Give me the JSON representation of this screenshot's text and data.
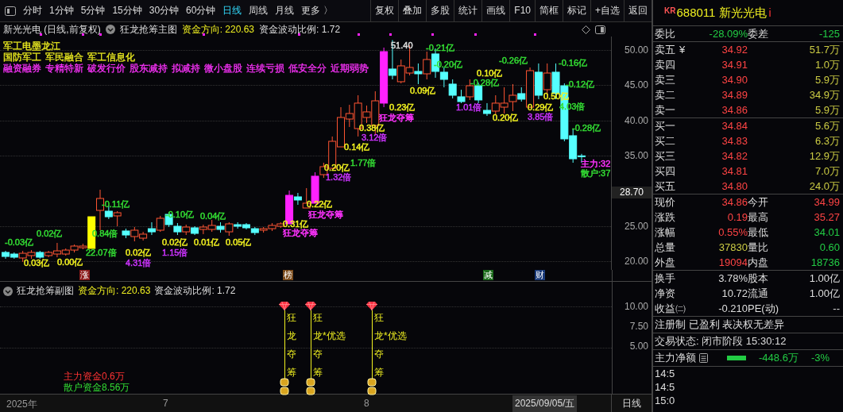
{
  "toolbar": {
    "periods": [
      {
        "label": "分时",
        "selected": false
      },
      {
        "label": "1分钟",
        "selected": false
      },
      {
        "label": "5分钟",
        "selected": false
      },
      {
        "label": "15分钟",
        "selected": false
      },
      {
        "label": "30分钟",
        "selected": false
      },
      {
        "label": "60分钟",
        "selected": false
      },
      {
        "label": "日线",
        "selected": true
      },
      {
        "label": "周线",
        "selected": false
      },
      {
        "label": "月线",
        "selected": false
      }
    ],
    "more": "更多 〉",
    "actions": [
      "复权",
      "叠加",
      "多股",
      "统计",
      "画线",
      "F10",
      "简框",
      "标记",
      "+自选",
      "返回"
    ]
  },
  "main_chart": {
    "title": "新光光电 (日线,前复权)",
    "indicator": "狂龙抢筹主图",
    "fund_direction": "资金方向: 220.63",
    "fund_ratio": "资金波动比例: 1.72",
    "concept_lines": [
      {
        "color": "#f0f020",
        "tags": [
          "军工电墨龙江"
        ]
      },
      {
        "color": "#f0f020",
        "tags": [
          "国防军工",
          "军民融合",
          "军工信息化"
        ]
      },
      {
        "color": "#ff33ff",
        "tags": [
          "融资融券",
          "专精特新",
          "破发行价",
          "股东减持",
          "拟减持",
          "微小盘股",
          "连续亏损",
          "低安全分",
          "近期弱势"
        ]
      }
    ],
    "chart_data": {
      "type": "candlestick",
      "ylim": [
        18.81,
        51.91
      ],
      "grid": true,
      "yticks": [
        {
          "value": 50,
          "label": "50.00"
        },
        {
          "value": 45,
          "label": "45.00"
        },
        {
          "value": 40,
          "label": "40.00"
        },
        {
          "value": 35,
          "label": "35.00"
        },
        {
          "value": 25,
          "label": "25.00"
        },
        {
          "value": 20,
          "label": "20.00"
        }
      ],
      "ohlc": [
        [
          21.29,
          21.51,
          20.39,
          20.72
        ],
        [
          21.06,
          21.29,
          20.39,
          20.61
        ],
        [
          20.5,
          21.51,
          19.94,
          21.17
        ],
        [
          20.84,
          21.62,
          20.39,
          21.29
        ],
        [
          21.29,
          21.51,
          20.39,
          20.61
        ],
        [
          20.84,
          21.51,
          20.61,
          21.29
        ],
        [
          21.06,
          22.64,
          20.61,
          21.51
        ],
        [
          21.06,
          21.85,
          20.84,
          21.62
        ],
        [
          21.62,
          22.41,
          21.29,
          22.19
        ],
        [
          21.96,
          22.53,
          21.74,
          22.19
        ],
        [
          21.85,
          26.35,
          21.85,
          26.35
        ],
        [
          27.25,
          30.18,
          24.44,
          28.94
        ],
        [
          27.14,
          27.93,
          26.02,
          26.35
        ],
        [
          26.47,
          27.14,
          25.0,
          26.92
        ],
        [
          24.33,
          24.66,
          23.31,
          23.76
        ],
        [
          23.54,
          24.89,
          22.86,
          24.44
        ],
        [
          23.31,
          24.21,
          22.98,
          23.88
        ],
        [
          24.66,
          25.57,
          23.76,
          24.21
        ],
        [
          24.44,
          26.47,
          24.21,
          26.13
        ],
        [
          26.69,
          27.03,
          24.89,
          25.23
        ],
        [
          25.0,
          25.45,
          23.76,
          24.21
        ],
        [
          24.21,
          25.23,
          23.76,
          24.89
        ],
        [
          24.78,
          25.0,
          23.76,
          23.99
        ],
        [
          24.55,
          25.23,
          23.88,
          24.89
        ],
        [
          24.55,
          25.9,
          24.21,
          25.12
        ],
        [
          25.0,
          25.57,
          24.1,
          24.55
        ],
        [
          24.21,
          25.57,
          23.65,
          25.34
        ],
        [
          25.23,
          25.57,
          24.66,
          25.0
        ],
        [
          25.23,
          25.45,
          24.55,
          24.78
        ],
        [
          24.66,
          24.89,
          23.76,
          24.1
        ],
        [
          24.44,
          24.89,
          24.1,
          24.66
        ],
        [
          24.66,
          25.45,
          24.33,
          25.12
        ],
        [
          25.0,
          25.57,
          24.78,
          25.34
        ],
        [
          25.34,
          30.07,
          25.34,
          29.39
        ],
        [
          29.17,
          29.73,
          28.04,
          28.72
        ],
        [
          27.59,
          30.41,
          27.59,
          28.27
        ],
        [
          28.27,
          32.66,
          28.27,
          32.1
        ],
        [
          32.32,
          34.01,
          31.87,
          33.45
        ],
        [
          33.22,
          37.73,
          33.11,
          37.05
        ],
        [
          36.26,
          41.89,
          36.26,
          40.43
        ],
        [
          40.2,
          42.23,
          39.08,
          40.99
        ],
        [
          38.85,
          43.58,
          37.73,
          42.46
        ],
        [
          40.43,
          42.12,
          39.64,
          41.22
        ],
        [
          39.3,
          44.14,
          37.95,
          42.79
        ],
        [
          42.46,
          50.34,
          41.89,
          49.77
        ],
        [
          47.3,
          51.4,
          45.83,
          46.4
        ],
        [
          45.5,
          48.65,
          45.27,
          47.75
        ],
        [
          46.73,
          50.68,
          46.4,
          47.52
        ],
        [
          46.96,
          48.09,
          45.16,
          46.62
        ],
        [
          46.62,
          49.77,
          45.83,
          48.65
        ],
        [
          49.44,
          50.23,
          46.06,
          46.96
        ],
        [
          46.85,
          47.52,
          44.71,
          45.83
        ],
        [
          45.16,
          45.83,
          43.13,
          43.58
        ],
        [
          43.36,
          44.37,
          42.46,
          42.68
        ],
        [
          43.36,
          45.83,
          42.91,
          44.93
        ],
        [
          44.93,
          45.38,
          42.46,
          42.91
        ],
        [
          41.44,
          42.46,
          40.65,
          40.99
        ],
        [
          41.33,
          43.58,
          40.77,
          42.46
        ],
        [
          41.89,
          44.71,
          40.99,
          42.46
        ],
        [
          42.68,
          45.16,
          41.33,
          43.58
        ],
        [
          43.81,
          44.71,
          42.68,
          43.02
        ],
        [
          41.89,
          47.52,
          41.78,
          47.07
        ],
        [
          46.85,
          48.09,
          43.02,
          43.58
        ],
        [
          44.37,
          48.09,
          43.58,
          46.73
        ],
        [
          46.85,
          48.09,
          43.02,
          43.81
        ],
        [
          44.93,
          45.27,
          37.05,
          37.39
        ],
        [
          37.84,
          38.85,
          34.01,
          34.57
        ],
        [
          34.99,
          35.27,
          34.01,
          34.86
        ]
      ],
      "colors": [
        null,
        null,
        null,
        null,
        null,
        null,
        null,
        null,
        null,
        null,
        "#ffff00",
        null,
        null,
        null,
        null,
        null,
        null,
        null,
        null,
        null,
        null,
        null,
        null,
        null,
        null,
        null,
        null,
        null,
        null,
        null,
        null,
        null,
        null,
        "#ff22ff",
        null,
        null,
        "#ff22ff",
        null,
        null,
        null,
        null,
        null,
        null,
        null,
        "#ff22ff",
        null,
        null,
        null,
        null,
        null,
        null,
        null,
        null,
        null,
        null,
        null,
        null,
        null,
        null,
        null,
        null,
        null,
        null,
        null,
        null,
        null,
        null,
        null
      ]
    },
    "annotations": [
      {
        "text": "51.40",
        "color": "#dddddd"
      },
      {
        "text": "-0.21亿",
        "color": "#33dd33"
      },
      {
        "text": "-0.20亿",
        "color": "#33dd33"
      },
      {
        "text": "-0.26亿",
        "color": "#33dd33"
      },
      {
        "text": "-0.16亿",
        "color": "#33dd33"
      },
      {
        "text": "0.10亿",
        "color": "#f0f020"
      },
      {
        "text": "0.09亿",
        "color": "#f0f020"
      },
      {
        "text": "-0.28亿",
        "color": "#33dd33"
      },
      {
        "text": "-0.12亿",
        "color": "#33dd33"
      },
      {
        "text": "0.50亿",
        "color": "#f0f020"
      },
      {
        "text": "0.23亿",
        "color": "#f0f020"
      },
      {
        "text": "1.01倍",
        "color": "#cc33ff"
      },
      {
        "text": "0.29亿",
        "color": "#f0f020"
      },
      {
        "text": "4.03倍",
        "color": "#33dd33"
      },
      {
        "text": "狂龙夺筹",
        "color": "#ff33ff"
      },
      {
        "text": "0.20亿",
        "color": "#f0f020"
      },
      {
        "text": "3.85倍",
        "color": "#cc33ff"
      },
      {
        "text": "0.38亿",
        "color": "#f0f020"
      },
      {
        "text": "-0.28亿",
        "color": "#33dd33"
      },
      {
        "text": "3.12倍",
        "color": "#cc33ff"
      },
      {
        "text": "0.14亿",
        "color": "#f0f020"
      },
      {
        "text": "0.20亿",
        "color": "#f0f020"
      },
      {
        "text": "1.77倍",
        "color": "#33dd33"
      },
      {
        "text": "主力:32",
        "color": "#ff33ff"
      },
      {
        "text": "1.32倍",
        "color": "#cc33ff"
      },
      {
        "text": "散户:37",
        "color": "#33dd33"
      },
      {
        "text": "-0.11亿",
        "color": "#33dd33"
      },
      {
        "text": "0.22亿",
        "color": "#f0f020"
      },
      {
        "text": "-0.10亿",
        "color": "#33dd33"
      },
      {
        "text": "0.04亿",
        "color": "#33dd33"
      },
      {
        "text": "狂龙夺筹",
        "color": "#ff33ff"
      },
      {
        "text": "0.31亿",
        "color": "#f0f020"
      },
      {
        "text": "0.02亿",
        "color": "#33dd33"
      },
      {
        "text": "0.84倍",
        "color": "#33dd33"
      },
      {
        "text": "狂龙夺筹",
        "color": "#ff33ff"
      },
      {
        "text": "-0.03亿",
        "color": "#33dd33"
      },
      {
        "text": "0.02亿",
        "color": "#f0f020"
      },
      {
        "text": "0.01亿",
        "color": "#f0f020"
      },
      {
        "text": "0.05亿",
        "color": "#f0f020"
      },
      {
        "text": "22.07倍",
        "color": "#33dd33"
      },
      {
        "text": "0.02亿",
        "color": "#f0f020"
      },
      {
        "text": "1.15倍",
        "color": "#cc33ff"
      },
      {
        "text": "0.03亿",
        "color": "#f0f020"
      },
      {
        "text": "0.00亿",
        "color": "#f0f020"
      },
      {
        "text": "4.31倍",
        "color": "#cc33ff"
      }
    ],
    "current_price": "28.70"
  },
  "event_markers": [
    {
      "label": "涨",
      "color": "#8b1a1a"
    },
    {
      "label": "榜",
      "color": "#7a4a1a"
    },
    {
      "label": "减",
      "color": "#1a6a1a"
    },
    {
      "label": "财",
      "color": "#1a3a7a"
    }
  ],
  "sub_chart": {
    "indicator": "狂龙抢筹副图",
    "fund_direction": "资金方向: 220.63",
    "fund_ratio": "资金波动比例: 1.72",
    "ticks": [
      "10.00",
      "7.50",
      "5.00"
    ],
    "signals": [
      {
        "lines": [
          "狂",
          "龙",
          "夺",
          "筹"
        ]
      },
      {
        "lines": [
          "狂",
          "龙*优选",
          "夺",
          "筹"
        ]
      },
      {
        "lines": [
          "狂",
          "龙*优选",
          "夺",
          "筹"
        ]
      }
    ],
    "main_fund": "主力资金0.6万",
    "retail_fund": "散户资金8.56万"
  },
  "date_axis": {
    "labels": [
      "2025年",
      "7",
      "8"
    ],
    "cursor_date": "2025/09/05/五",
    "period": "日线"
  },
  "quote_panel": {
    "badge": "KR",
    "code": "688011",
    "name": "新光光电",
    "info_mark": "i",
    "order_ratio": [
      {
        "label": "委比",
        "value": "-28.09%",
        "color": "#22cc44"
      },
      {
        "label": "委差",
        "value": "-125",
        "color": "#22cc44"
      }
    ],
    "ask_symbol": "¥",
    "asks": [
      {
        "label": "卖五",
        "price": "34.92",
        "volume": "51.7万"
      },
      {
        "label": "卖四",
        "price": "34.91",
        "volume": "1.0万"
      },
      {
        "label": "卖三",
        "price": "34.90",
        "volume": "5.9万"
      },
      {
        "label": "卖二",
        "price": "34.89",
        "volume": "34.9万"
      },
      {
        "label": "卖一",
        "price": "34.86",
        "volume": "5.9万"
      }
    ],
    "bids": [
      {
        "label": "买一",
        "price": "34.84",
        "volume": "5.6万"
      },
      {
        "label": "买二",
        "price": "34.83",
        "volume": "6.3万"
      },
      {
        "label": "买三",
        "price": "34.82",
        "volume": "12.9万"
      },
      {
        "label": "买四",
        "price": "34.81",
        "volume": "7.0万"
      },
      {
        "label": "买五",
        "price": "34.80",
        "volume": "24.0万"
      }
    ],
    "stats": [
      [
        {
          "label": "现价",
          "value": "34.86",
          "color": "#ff4444"
        },
        {
          "label": "今开",
          "value": "34.99",
          "color": "#ff4444"
        }
      ],
      [
        {
          "label": "涨跌",
          "value": "0.19",
          "color": "#ff4444"
        },
        {
          "label": "最高",
          "value": "35.27",
          "color": "#ff4444"
        }
      ],
      [
        {
          "label": "涨幅",
          "value": "0.55%",
          "color": "#ff4444"
        },
        {
          "label": "最低",
          "value": "34.01",
          "color": "#22cc44"
        }
      ],
      [
        {
          "label": "总量",
          "value": "37830",
          "color": "#cccc44"
        },
        {
          "label": "量比",
          "value": "0.60",
          "color": "#22cc44"
        }
      ],
      [
        {
          "label": "外盘",
          "value": "19094",
          "color": "#ff4444"
        },
        {
          "label": "内盘",
          "value": "18736",
          "color": "#22cc44"
        }
      ]
    ],
    "fundamentals": [
      [
        {
          "label": "换手",
          "value": "3.78%"
        },
        {
          "label": "股本",
          "value": "1.00亿"
        }
      ],
      [
        {
          "label": "净资",
          "value": "10.72"
        },
        {
          "label": "流通",
          "value": "1.00亿"
        }
      ],
      [
        {
          "label": "收益㈡",
          "value": "-0.210"
        },
        {
          "label": "PE(动)",
          "value": "--"
        }
      ]
    ],
    "tags": "注册制 已盈利 表决权无差异",
    "trade_status": "交易状态: 闭市阶段 15:30:12",
    "main_net": {
      "label": "主力净额",
      "value": "-448.6万",
      "percent": "-3%",
      "color": "#22cc44"
    },
    "times": [
      "14:5",
      "14:5",
      "15:0"
    ]
  }
}
